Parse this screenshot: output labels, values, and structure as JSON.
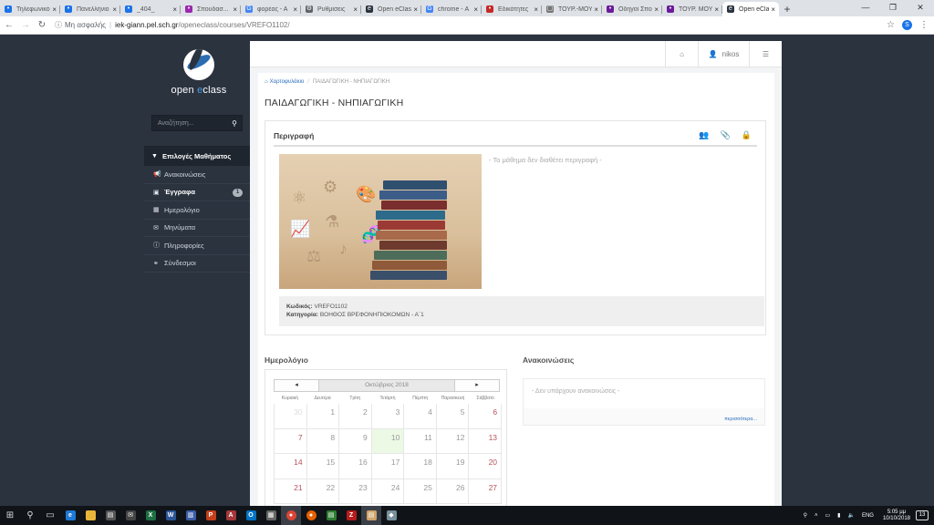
{
  "browser": {
    "tabs": [
      {
        "title": "Τηλεφωνικό",
        "color": "#1a73e8",
        "glyph": "•"
      },
      {
        "title": "Πανελλήνιο",
        "color": "#1a73e8",
        "glyph": "•"
      },
      {
        "title": "_404_",
        "color": "#1a73e8",
        "glyph": "•"
      },
      {
        "title": "Σπουδασ...",
        "color": "#9c27b0",
        "glyph": "•"
      },
      {
        "title": "φορέας - Α",
        "color": "#4285f4",
        "glyph": "G"
      },
      {
        "title": "Ρυθμίσεις",
        "color": "#5f6368",
        "glyph": "⚙"
      },
      {
        "title": "Open eClas",
        "color": "#2b333f",
        "glyph": "e"
      },
      {
        "title": "chrome - Α",
        "color": "#4285f4",
        "glyph": "G"
      },
      {
        "title": "Εδικότητες",
        "color": "#c62828",
        "glyph": "•"
      },
      {
        "title": "ΤΟΥΡ.-ΜΟΥ",
        "color": "#757575",
        "glyph": "▢"
      },
      {
        "title": "Οδηγοί Σπο",
        "color": "#6a1b9a",
        "glyph": "•"
      },
      {
        "title": "ΤΟΥΡ. ΜΟΥ",
        "color": "#6a1b9a",
        "glyph": "•"
      },
      {
        "title": "Open eClas",
        "color": "#2b333f",
        "glyph": "e",
        "active": true
      }
    ],
    "close_glyph": "×",
    "new_tab_glyph": "+",
    "not_secure": "Μη ασφαλής",
    "url_host": "iek-giann.pel.sch.gr",
    "url_path": "/openeclass/courses/VREFO1102/",
    "profile_initial": "S"
  },
  "logo": {
    "open": "open ",
    "e": "e",
    "class": "class"
  },
  "search": {
    "placeholder": "Αναζήτηση..."
  },
  "sidebar": {
    "heading": "Επιλογές Μαθήματος",
    "items": [
      {
        "label": "Ανακοινώσεις",
        "icon": "megaphone-icon",
        "glyph": "📢"
      },
      {
        "label": "Έγγραφα",
        "icon": "folder-icon",
        "glyph": "▣",
        "active": true,
        "badge": "1"
      },
      {
        "label": "Ημερολόγιο",
        "icon": "calendar-icon",
        "glyph": "▦"
      },
      {
        "label": "Μηνύματα",
        "icon": "envelope-icon",
        "glyph": "✉"
      },
      {
        "label": "Πληροφορίες",
        "icon": "info-icon",
        "glyph": "ⓘ"
      },
      {
        "label": "Σύνδεσμοι",
        "icon": "link-icon",
        "glyph": "⚭"
      }
    ]
  },
  "topbar": {
    "username": "nikos"
  },
  "breadcrumb": {
    "root": "Χαρτοφυλάκιο",
    "current": "ΠΑΙΔΑΓΩΓΙΚΗ - ΝΗΠΙΑΓΩΓΙΚΗ"
  },
  "course": {
    "title": "ΠΑΙΔΑΓΩΓΙΚΗ - ΝΗΠΙΑΓΩΓΙΚΗ",
    "panel_title": "Περιγραφή",
    "no_description": "- Το μάθημα δεν διαθέτει περιγραφή -",
    "code_label": "Κωδικός:",
    "code_value": "VREFO1102",
    "category_label": "Κατηγορία:",
    "category_value": "ΒΟΗΘΟΣ ΒΡΕΦΟΝΗΠΙΟΚΟΜΩΝ - Α΄1"
  },
  "calendar": {
    "title": "Ημερολόγιο",
    "month": "Οκτώβριος 2018",
    "prev": "◂",
    "next": "▸",
    "dow": [
      "Κυριακή",
      "Δευτέρα",
      "Τρίτη",
      "Τετάρτη",
      "Πέμπτη",
      "Παρασκευή",
      "Σάββατο"
    ],
    "weeks": [
      [
        "30",
        "1",
        "2",
        "3",
        "4",
        "5",
        "6"
      ],
      [
        "7",
        "8",
        "9",
        "10",
        "11",
        "12",
        "13"
      ],
      [
        "14",
        "15",
        "16",
        "17",
        "18",
        "19",
        "20"
      ],
      [
        "21",
        "22",
        "23",
        "24",
        "25",
        "26",
        "27"
      ]
    ],
    "today": "10",
    "outside_month": [
      "30"
    ]
  },
  "announcements": {
    "title": "Ανακοινώσεις",
    "empty": "- Δεν υπάρχουν ανακοινώσεις -",
    "more": "περισσότερα..."
  },
  "taskbar": {
    "lang": "ENG",
    "time": "5:05 μμ",
    "date": "10/10/2018",
    "notifications": "13"
  }
}
